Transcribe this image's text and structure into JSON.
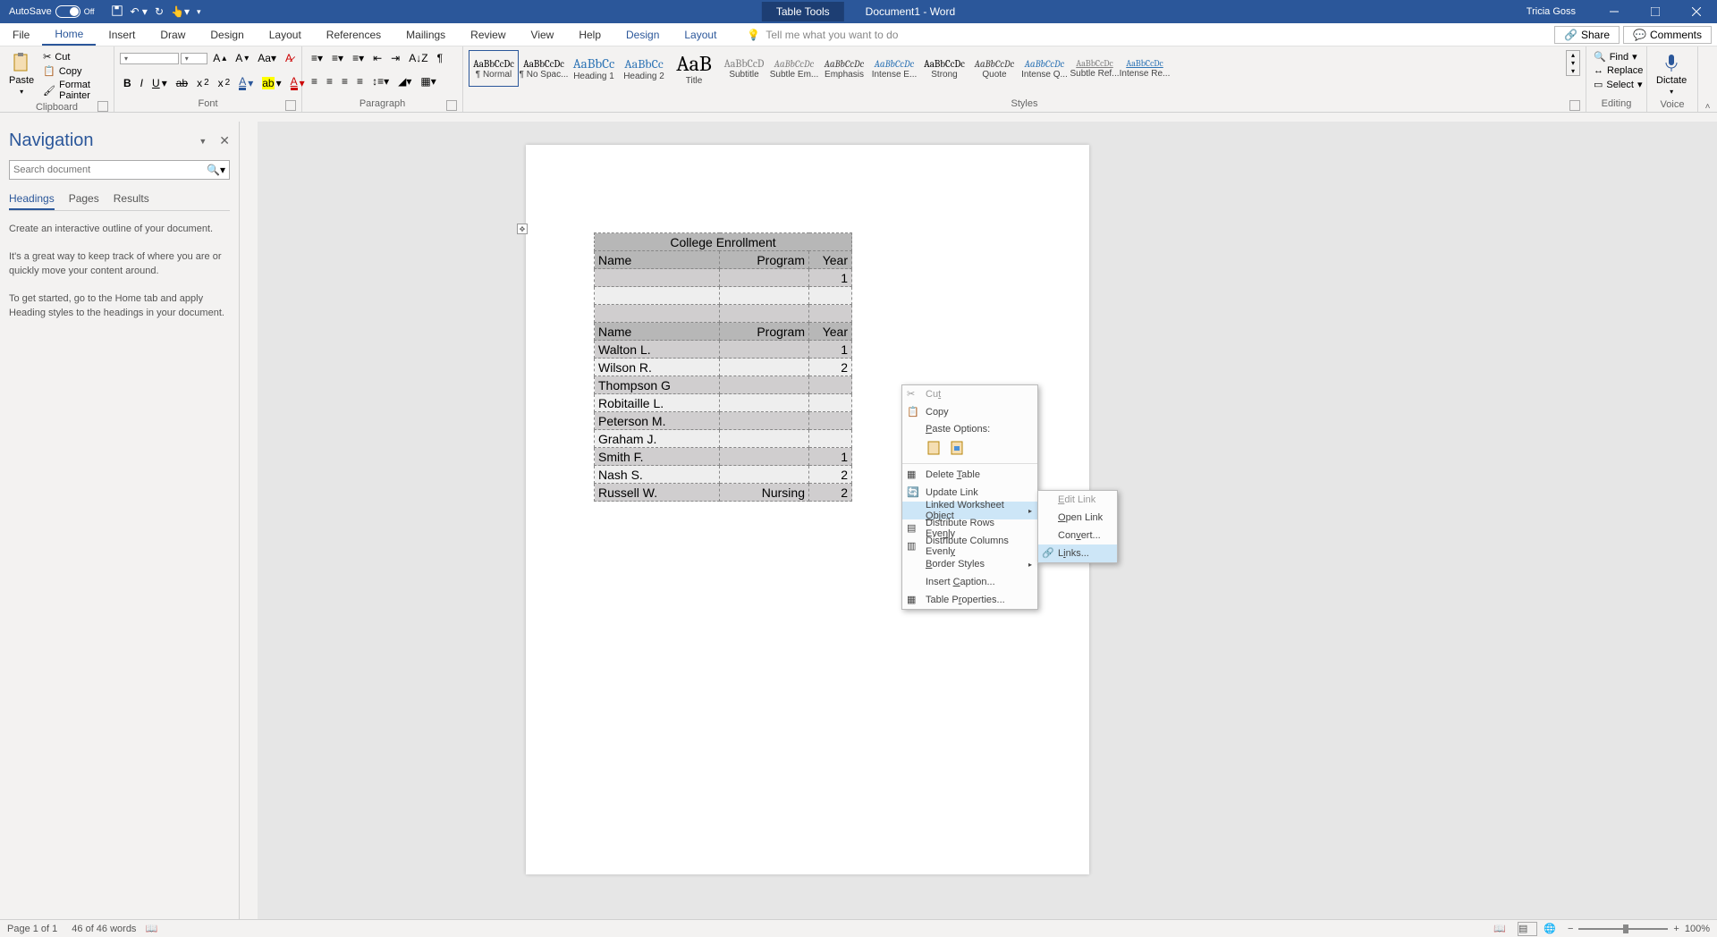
{
  "titlebar": {
    "autosave": "AutoSave",
    "autosave_state": "Off",
    "doc_title": "Document1  -  Word",
    "table_tools": "Table Tools",
    "user": "Tricia Goss"
  },
  "tabs": {
    "file": "File",
    "home": "Home",
    "insert": "Insert",
    "draw": "Draw",
    "design": "Design",
    "layout": "Layout",
    "references": "References",
    "mailings": "Mailings",
    "review": "Review",
    "view": "View",
    "help": "Help",
    "tdesign": "Design",
    "tlayout": "Layout",
    "tellme": "Tell me what you want to do",
    "share": "Share",
    "comments": "Comments"
  },
  "ribbon": {
    "paste": "Paste",
    "cut": "Cut",
    "copy": "Copy",
    "formatpainter": "Format Painter",
    "clipboard": "Clipboard",
    "font": "Font",
    "paragraph": "Paragraph",
    "styles_label": "Styles",
    "editing": "Editing",
    "voice": "Voice",
    "find": "Find",
    "replace": "Replace",
    "select": "Select",
    "dictate": "Dictate",
    "styles": [
      {
        "preview": "AaBbCcDc",
        "name": "¶ Normal"
      },
      {
        "preview": "AaBbCcDc",
        "name": "¶ No Spac..."
      },
      {
        "preview": "AaBbCc",
        "name": "Heading 1"
      },
      {
        "preview": "AaBbCc",
        "name": "Heading 2"
      },
      {
        "preview": "AaB",
        "name": "Title"
      },
      {
        "preview": "AaBbCcD",
        "name": "Subtitle"
      },
      {
        "preview": "AaBbCcDc",
        "name": "Subtle Em..."
      },
      {
        "preview": "AaBbCcDc",
        "name": "Emphasis"
      },
      {
        "preview": "AaBbCcDc",
        "name": "Intense E..."
      },
      {
        "preview": "AaBbCcDc",
        "name": "Strong"
      },
      {
        "preview": "AaBbCcDc",
        "name": "Quote"
      },
      {
        "preview": "AaBbCcDc",
        "name": "Intense Q..."
      },
      {
        "preview": "AaBbCcDc",
        "name": "Subtle Ref..."
      },
      {
        "preview": "AaBbCcDc",
        "name": "Intense Re..."
      }
    ]
  },
  "nav": {
    "title": "Navigation",
    "search_placeholder": "Search document",
    "tab_headings": "Headings",
    "tab_pages": "Pages",
    "tab_results": "Results",
    "p1": "Create an interactive outline of your document.",
    "p2": "It's a great way to keep track of where you are or quickly move your content around.",
    "p3": "To get started, go to the Home tab and apply Heading styles to the headings in your document."
  },
  "table": {
    "title": "College Enrollment",
    "h_name": "Name",
    "h_program": "Program",
    "h_year": "Year",
    "rows1": [
      {
        "name": "",
        "program": "",
        "year": "1"
      },
      {
        "name": "",
        "program": "",
        "year": ""
      },
      {
        "name": "",
        "program": "",
        "year": ""
      }
    ],
    "rows2": [
      {
        "name": "Walton L.",
        "program": "",
        "year": "1"
      },
      {
        "name": "Wilson R.",
        "program": "",
        "year": "2"
      },
      {
        "name": "Thompson G",
        "program": "",
        "year": ""
      },
      {
        "name": "Robitaille L.",
        "program": "",
        "year": ""
      },
      {
        "name": "Peterson M.",
        "program": "",
        "year": ""
      },
      {
        "name": "Graham J.",
        "program": "",
        "year": ""
      },
      {
        "name": "Smith F.",
        "program": "",
        "year": "1"
      },
      {
        "name": "Nash S.",
        "program": "",
        "year": "2"
      },
      {
        "name": "Russell W.",
        "program": "Nursing",
        "year": "2"
      }
    ]
  },
  "ctx": {
    "cut": "Cut",
    "copy": "Copy",
    "paste_options": "Paste Options:",
    "delete_table": "Delete Table",
    "update_link": "Update Link",
    "linked_ws": "Linked Worksheet Object",
    "dist_rows": "Distribute Rows Evenly",
    "dist_cols": "Distribute Columns Evenly",
    "border_styles": "Border Styles",
    "insert_caption": "Insert Caption...",
    "table_props": "Table Properties..."
  },
  "sub": {
    "edit": "Edit  Link",
    "open": "Open  Link",
    "convert": "Convert...",
    "links": "Links..."
  },
  "status": {
    "page": "Page 1 of 1",
    "words": "46 of 46 words",
    "zoom": "100%"
  }
}
